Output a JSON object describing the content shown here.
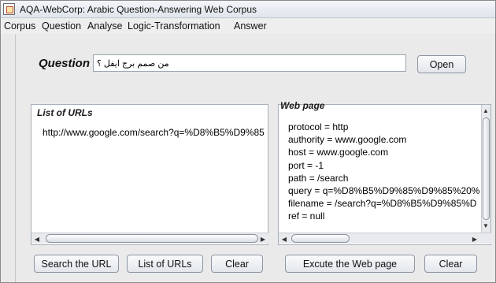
{
  "window": {
    "title": "AQA-WebCorp: Arabic Question-Answering Web Corpus",
    "app_icon": "java-app-icon"
  },
  "menu": {
    "items": [
      "Corpus",
      "Question",
      "Analyse",
      "Logic-Transformation",
      "Answer"
    ]
  },
  "question": {
    "label": "Question",
    "value": "من صمم برج ايفل ؟",
    "open_label": "Open"
  },
  "urls_panel": {
    "title": "List of URLs",
    "url": "http://www.google.com/search?q=%D8%B5%D9%85"
  },
  "webpage_panel": {
    "title": "Web page",
    "lines": [
      "protocol = http",
      "authority = www.google.com",
      "host = www.google.com",
      "port = -1",
      "path = /search",
      "query = q=%D8%B5%D9%85%D9%85%20%",
      "filename = /search?q=%D8%B5%D9%85%D",
      "ref = null"
    ]
  },
  "buttons": {
    "search_url": "Search the URL",
    "list_urls": "List of URLs",
    "clear_left": "Clear",
    "execute_page": "Excute  the Web page",
    "clear_right": "Clear"
  }
}
